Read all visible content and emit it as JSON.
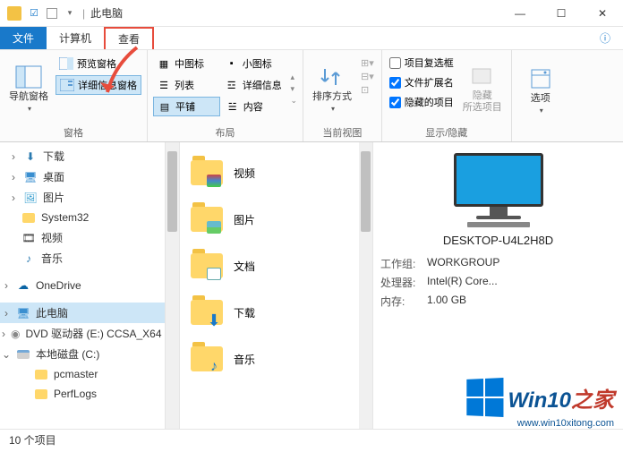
{
  "titlebar": {
    "title": "此电脑"
  },
  "wincontrols": {
    "min": "—",
    "max": "☐",
    "close": "✕"
  },
  "tabs": {
    "file": "文件",
    "computer": "计算机",
    "view": "查看"
  },
  "ribbon": {
    "panes_group": "窗格",
    "nav_pane": "导航窗格",
    "preview_pane": "预览窗格",
    "details_pane": "详细信息窗格",
    "layout_group": "布局",
    "medium_icons": "中图标",
    "small_icons": "小图标",
    "list": "列表",
    "details": "详细信息",
    "tiles": "平铺",
    "content": "内容",
    "current_view_group": "当前视图",
    "sort_by": "排序方式",
    "show_hide_group": "显示/隐藏",
    "item_checkboxes": "项目复选框",
    "file_ext": "文件扩展名",
    "hidden_items": "隐藏的项目",
    "hide_selected": "隐藏\n所选项目",
    "options": "选项"
  },
  "sidebar": {
    "items": [
      {
        "label": "下载",
        "icon": "download"
      },
      {
        "label": "桌面",
        "icon": "desktop"
      },
      {
        "label": "图片",
        "icon": "pictures"
      },
      {
        "label": "System32",
        "icon": "folder"
      },
      {
        "label": "视频",
        "icon": "video"
      },
      {
        "label": "音乐",
        "icon": "music"
      },
      {
        "label": "OneDrive",
        "icon": "onedrive",
        "top": true
      },
      {
        "label": "此电脑",
        "icon": "pc",
        "top": true,
        "selected": true
      },
      {
        "label": "DVD 驱动器 (E:) CCSA_X64",
        "icon": "dvd",
        "top": true
      },
      {
        "label": "本地磁盘 (C:)",
        "icon": "disk",
        "top": true
      },
      {
        "label": "pcmaster",
        "icon": "folder",
        "indent": true
      },
      {
        "label": "PerfLogs",
        "icon": "folder",
        "indent": true
      }
    ]
  },
  "files": [
    {
      "label": "视频",
      "badge": "video"
    },
    {
      "label": "图片",
      "badge": "picture"
    },
    {
      "label": "文档",
      "badge": "doc"
    },
    {
      "label": "下载",
      "badge": "download"
    },
    {
      "label": "音乐",
      "badge": "music"
    }
  ],
  "details": {
    "name": "DESKTOP-U4L2H8D",
    "rows": [
      {
        "label": "工作组:",
        "value": "WORKGROUP"
      },
      {
        "label": "处理器:",
        "value": "Intel(R) Core..."
      },
      {
        "label": "内存:",
        "value": "1.00 GB"
      }
    ]
  },
  "statusbar": {
    "count": "10 个项目"
  },
  "watermark": {
    "brand": "Win10",
    "suffix": "之家",
    "url": "www.win10xitong.com"
  }
}
